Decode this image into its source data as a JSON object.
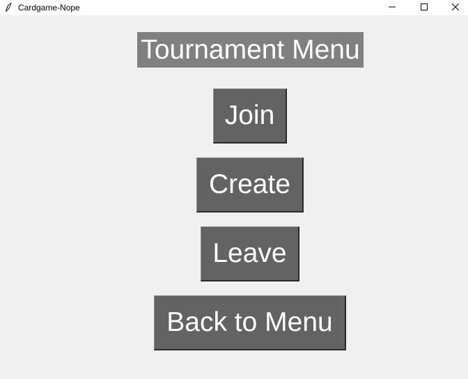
{
  "window": {
    "title": "Cardgame-Nope",
    "app_icon": "feather-icon"
  },
  "menu": {
    "heading": "Tournament Menu",
    "buttons": [
      {
        "label": "Join"
      },
      {
        "label": "Create"
      },
      {
        "label": "Leave"
      },
      {
        "label": "Back to Menu"
      }
    ]
  },
  "colors": {
    "background": "#f0f0f0",
    "heading_bg": "#808080",
    "button_bg": "#636363",
    "text": "#ffffff"
  }
}
